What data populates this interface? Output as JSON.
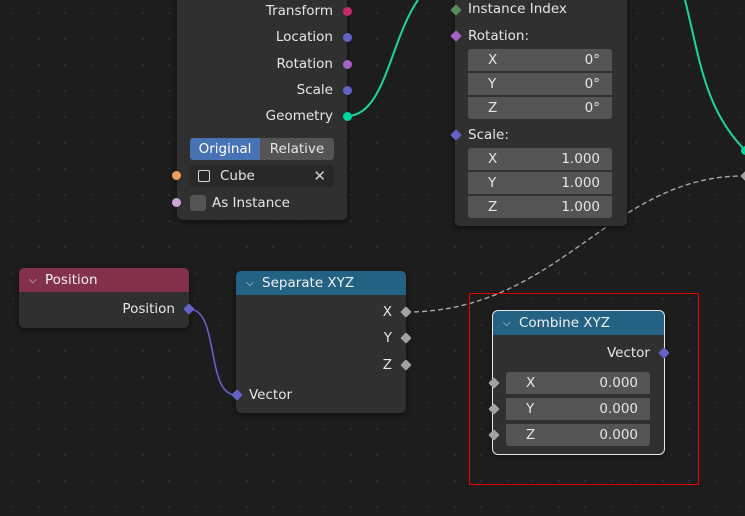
{
  "object_info": {
    "outputs": [
      "Transform",
      "Location",
      "Rotation",
      "Scale",
      "Geometry"
    ],
    "mode_toggle": {
      "active": "Original",
      "inactive": "Relative"
    },
    "object_field": "Cube",
    "as_instance": "As Instance"
  },
  "instance_node": {
    "instance_index": "Instance Index",
    "rotation_label": "Rotation:",
    "rotation": [
      {
        "axis": "X",
        "value": "0°"
      },
      {
        "axis": "Y",
        "value": "0°"
      },
      {
        "axis": "Z",
        "value": "0°"
      }
    ],
    "scale_label": "Scale:",
    "scale": [
      {
        "axis": "X",
        "value": "1.000"
      },
      {
        "axis": "Y",
        "value": "1.000"
      },
      {
        "axis": "Z",
        "value": "1.000"
      }
    ]
  },
  "position_node": {
    "title": "Position",
    "output": "Position"
  },
  "separate_xyz": {
    "title": "Separate XYZ",
    "outputs": [
      "X",
      "Y",
      "Z"
    ],
    "input": "Vector"
  },
  "combine_xyz": {
    "title": "Combine XYZ",
    "output": "Vector",
    "inputs": [
      {
        "axis": "X",
        "value": "0.000"
      },
      {
        "axis": "Y",
        "value": "0.000"
      },
      {
        "axis": "Z",
        "value": "0.000"
      }
    ]
  },
  "colors": {
    "geometry_socket": "#00d6a3",
    "vector_socket": "#6363c7",
    "rotation_socket": "#a363c7",
    "matrix_socket": "#c7296b",
    "float_socket": "#a1a1a1",
    "object_socket": "#ed9e5c",
    "bool_socket": "#cca6d6",
    "int_socket": "#598c5c",
    "input_header": "#83314a",
    "converter_header": "#246283",
    "selection_box": "#e00000"
  }
}
